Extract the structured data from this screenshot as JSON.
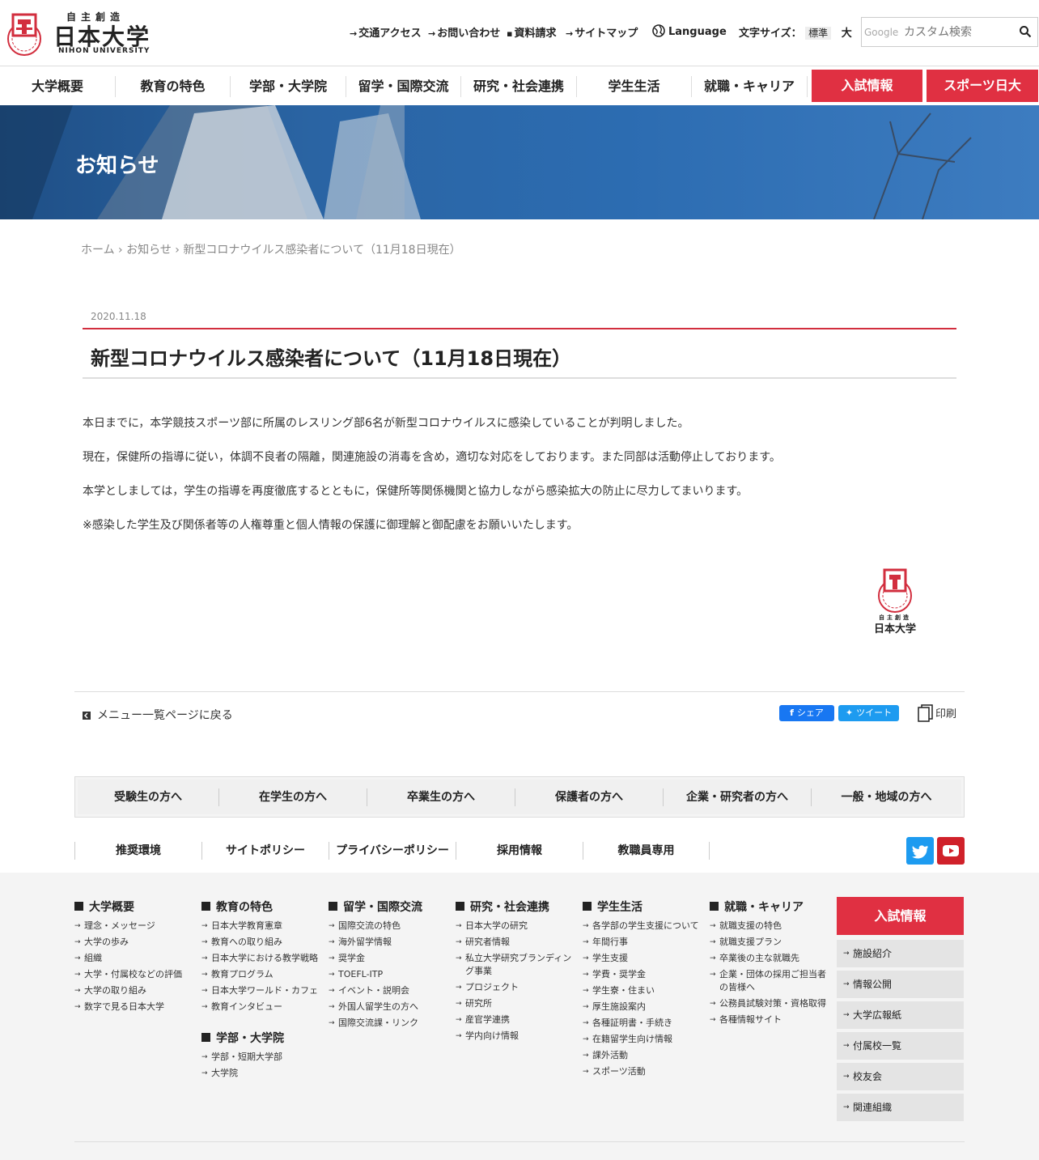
{
  "header": {
    "logo_sub": "自主創造",
    "logo_main": "日本大学",
    "logo_en": "NIHON UNIVERSITY",
    "util": {
      "access": "交通アクセス",
      "contact": "お問い合わせ",
      "request": "資料請求",
      "sitemap": "サイトマップ",
      "language": "Language",
      "fontsize_label": "文字サイズ：",
      "fontsize_std": "標準",
      "fontsize_large": "大"
    },
    "search": {
      "brand": "Google",
      "placeholder": "カスタム検索"
    }
  },
  "gnav": {
    "items": [
      "大学概要",
      "教育の特色",
      "学部・大学院",
      "留学・国際交流",
      "研究・社会連携",
      "学生生活",
      "就職・キャリア"
    ],
    "red": [
      "入試情報",
      "スポーツ日大"
    ]
  },
  "hero": {
    "title": "お知らせ"
  },
  "breadcrumb": {
    "home": "ホーム",
    "news": "お知らせ",
    "current": "新型コロナウイルス感染者について（11月18日現在）"
  },
  "article": {
    "date": "2020.11.18",
    "title": "新型コロナウイルス感染者について（11月18日現在）",
    "paragraphs": [
      "本日までに，本学競技スポーツ部に所属のレスリング部6名が新型コロナウイルスに感染していることが判明しました。",
      "現在，保健所の指導に従い，体調不良者の隔離，関連施設の消毒を含め，適切な対応をしております。また同部は活動停止しております。",
      "本学としましては，学生の指導を再度徹底するとともに，保健所等関係機関と協力しながら感染拡大の防止に尽力してまいります。",
      "※感染した学生及び関係者等の人権尊重と個人情報の保護に御理解と御配慮をお願いいたします。"
    ],
    "signature": {
      "sub": "自主創造",
      "main": "日本大学"
    }
  },
  "actions": {
    "back": "メニュー一覧ページに戻る",
    "share": "シェア",
    "tweet": "ツイート",
    "print": "印刷"
  },
  "audience": [
    "受験生の方へ",
    "在学生の方へ",
    "卒業生の方へ",
    "保護者の方へ",
    "企業・研究者の方へ",
    "一般・地域の方へ"
  ],
  "sublinks": [
    "推奨環境",
    "サイトポリシー",
    "プライバシーポリシー",
    "採用情報",
    "教職員専用"
  ],
  "footer": {
    "columns": [
      {
        "title": "大学概要",
        "links": [
          "理念・メッセージ",
          "大学の歩み",
          "組織",
          "大学・付属校などの評価",
          "大学の取り組み",
          "数字で見る日本大学"
        ]
      },
      {
        "title": "教育の特色",
        "links": [
          "日本大学教育憲章",
          "教育への取り組み",
          "日本大学における教学戦略",
          "教育プログラム",
          "日本大学ワールド・カフェ",
          "教育インタビュー"
        ]
      },
      {
        "title": "留学・国際交流",
        "links": [
          "国際交流の特色",
          "海外留学情報",
          "奨学金",
          "TOEFL-ITP",
          "イベント・説明会",
          "外国人留学生の方へ",
          "国際交流課・リンク"
        ]
      },
      {
        "title": "研究・社会連携",
        "links": [
          "日本大学の研究",
          "研究者情報",
          "私立大学研究ブランディング事業",
          "プロジェクト",
          "研究所",
          "産官学連携",
          "学内向け情報"
        ]
      },
      {
        "title": "学生生活",
        "links": [
          "各学部の学生支援について",
          "年間行事",
          "学生支援",
          "学費・奨学金",
          "学生寮・住まい",
          "厚生施設案内",
          "各種証明書・手続き",
          "在籍留学生向け情報",
          "課外活動",
          "スポーツ活動"
        ]
      },
      {
        "title": "就職・キャリア",
        "links": [
          "就職支援の特色",
          "就職支援プラン",
          "卒業後の主な就職先",
          "企業・団体の採用ご担当者の皆様へ",
          "公務員試験対策・資格取得",
          "各種情報サイト"
        ]
      }
    ],
    "column_gakubu": {
      "title": "学部・大学院",
      "links": [
        "学部・短期大学部",
        "大学院"
      ]
    },
    "side_red": "入試情報",
    "side_buttons": [
      "施設紹介",
      "情報公開",
      "大学広報紙",
      "付属校一覧",
      "校友会",
      "関連組織"
    ]
  },
  "colors": {
    "accent_red": "#e03042",
    "title_rule": "#d22e3e",
    "twitter": "#1d9bf0",
    "facebook": "#1877f2",
    "youtube": "#d0212a"
  }
}
